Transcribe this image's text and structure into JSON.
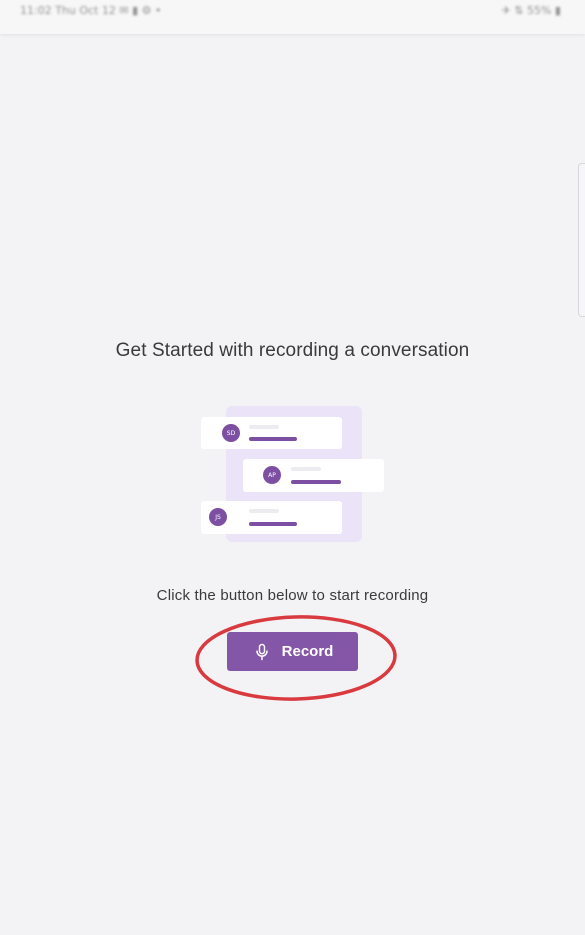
{
  "status_bar": {
    "left_text": "11:02 Thu Oct 12 ✉ ▮ ⚙ •",
    "right_text": "✈ ⇅ 55% ▮"
  },
  "main": {
    "title": "Get Started with recording a conversation",
    "subtitle": "Click the button below to start recording",
    "record_button": {
      "label": "Record",
      "icon": "microphone-icon"
    }
  },
  "illustration": {
    "avatars": [
      "SD",
      "AP",
      "JS"
    ]
  },
  "colors": {
    "accent": "#8456a7",
    "background": "#f3f3f5",
    "annotation": "#d93a3f",
    "panel": "#ebe4f8"
  }
}
